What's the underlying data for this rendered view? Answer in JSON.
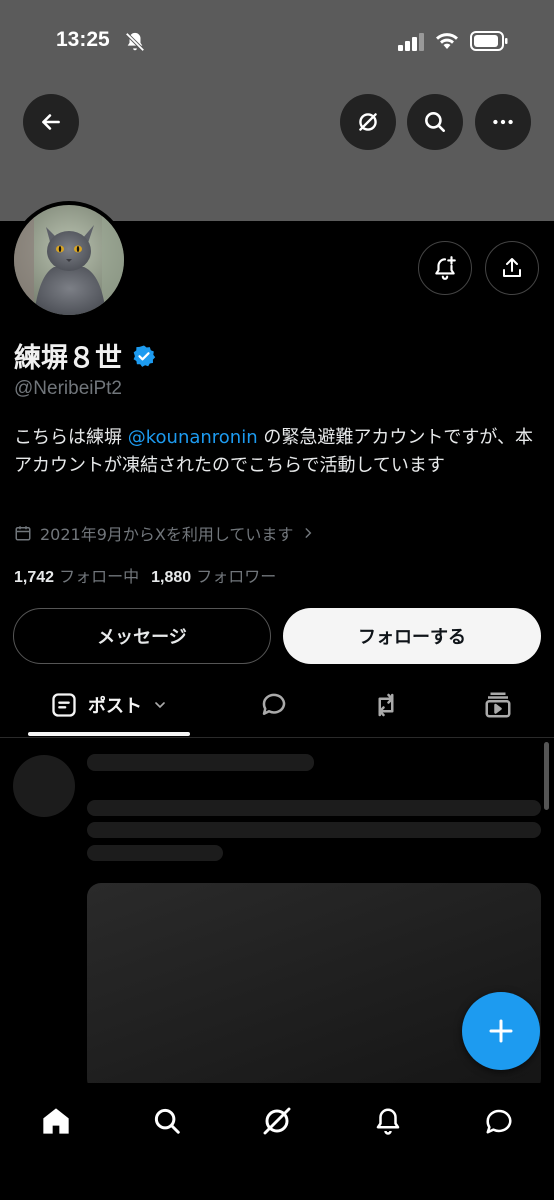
{
  "status_bar": {
    "time": "13:25"
  },
  "profile": {
    "name": "練塀８世",
    "handle": "@NeribeiPt2",
    "bio_before": "こちらは練塀 ",
    "bio_mention": "@kounanronin",
    "bio_after": " の緊急避難アカウントですが、本アカウントが凍結されたのでこちらで活動しています",
    "joined": "2021年9月からXを利用しています",
    "following_count": "1,742",
    "following_label": "フォロー中",
    "followers_count": "1,880",
    "followers_label": "フォロワー"
  },
  "actions": {
    "message_label": "メッセージ",
    "follow_label": "フォローする"
  },
  "tabs": {
    "posts_label": "ポスト"
  },
  "colors": {
    "accent": "#1d9bf0",
    "verified": "#1d9bf0",
    "banner": "#5b5b5b"
  },
  "icons": [
    "back-arrow-icon",
    "grok-icon",
    "search-icon",
    "more-icon",
    "notify-plus-icon",
    "share-icon",
    "verified-badge-icon",
    "calendar-icon",
    "home-icon",
    "bell-icon",
    "messages-icon"
  ]
}
